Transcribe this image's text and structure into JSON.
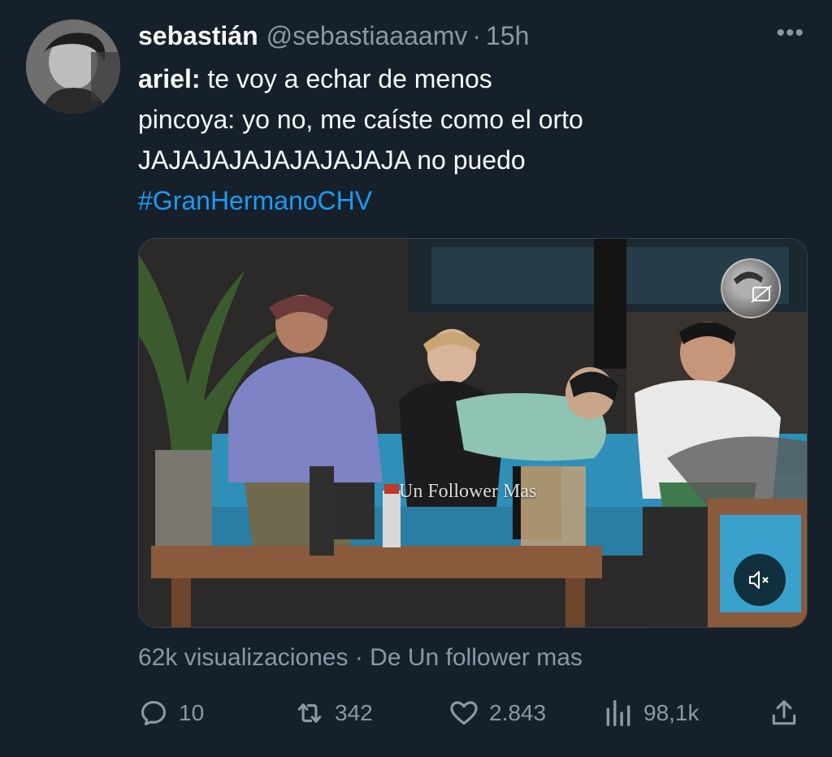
{
  "tweet": {
    "author": {
      "display_name": "sebastián",
      "handle": "@sebastiaaaamv",
      "separator": "·",
      "time": "15h"
    },
    "more_icon": "•••",
    "text": {
      "line1_speaker": "ariel:",
      "line1_text": " te voy a echar de menos",
      "line2": "pincoya: yo no, me caíste como el orto",
      "line3": "JAJAJAJAJAJAJAJAJA no puedo",
      "hashtag": "#GranHermanoCHV"
    },
    "media": {
      "watermark": "Un Follower Mas",
      "mute_icon": "speaker-muted-icon",
      "badge_icon": "cc-icon"
    },
    "views": {
      "count": "62k visualizaciones",
      "separator": "·",
      "from": "De Un follower mas"
    },
    "actions": {
      "reply": {
        "icon": "reply-icon",
        "count": "10"
      },
      "retweet": {
        "icon": "retweet-icon",
        "count": "342"
      },
      "like": {
        "icon": "heart-icon",
        "count": "2.843"
      },
      "views": {
        "icon": "analytics-icon",
        "count": "98,1k"
      },
      "share": {
        "icon": "share-icon"
      }
    },
    "colors": {
      "background": "#15202b",
      "text": "#f7f9f9",
      "muted": "#8b98a5",
      "link": "#1d9bf0"
    }
  }
}
